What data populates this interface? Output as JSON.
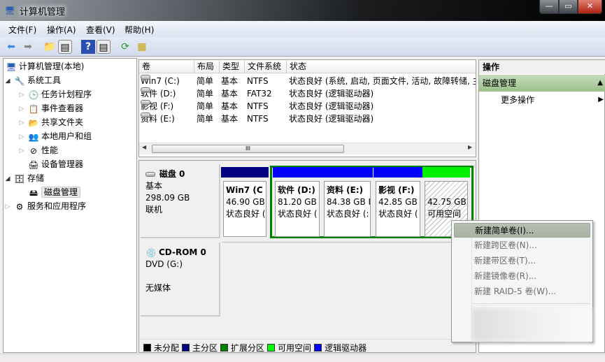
{
  "window": {
    "title": "计算机管理",
    "controls": [
      "minimize",
      "maximize",
      "close"
    ]
  },
  "menu": [
    {
      "label": "文件(F)"
    },
    {
      "label": "操作(A)"
    },
    {
      "label": "查看(V)"
    },
    {
      "label": "帮助(H)"
    }
  ],
  "toolbar": [
    "back-icon",
    "forward-icon",
    "up-folder-icon",
    "show-hide-tree-icon",
    "help-icon",
    "show-hide-action-icon",
    "refresh-icon",
    "properties-icon"
  ],
  "tree": {
    "root": "计算机管理(本地)",
    "items": [
      {
        "label": "系统工具",
        "level": 1,
        "expanded": true
      },
      {
        "label": "任务计划程序",
        "level": 2
      },
      {
        "label": "事件查看器",
        "level": 2
      },
      {
        "label": "共享文件夹",
        "level": 2
      },
      {
        "label": "本地用户和组",
        "level": 2
      },
      {
        "label": "性能",
        "level": 2
      },
      {
        "label": "设备管理器",
        "level": 2
      },
      {
        "label": "存储",
        "level": 1,
        "expanded": true
      },
      {
        "label": "磁盘管理",
        "level": 2,
        "selected": true
      },
      {
        "label": "服务和应用程序",
        "level": 1
      }
    ]
  },
  "volumes": {
    "columns": [
      "卷",
      "布局",
      "类型",
      "文件系统",
      "状态"
    ],
    "rows": [
      {
        "vol": "Win7 (C:)",
        "layout": "简单",
        "type": "基本",
        "fs": "NTFS",
        "status": "状态良好 (系统, 启动, 页面文件, 活动, 故障转储, 主"
      },
      {
        "vol": "软件 (D:)",
        "layout": "简单",
        "type": "基本",
        "fs": "FAT32",
        "status": "状态良好 (逻辑驱动器)"
      },
      {
        "vol": "影视 (F:)",
        "layout": "简单",
        "type": "基本",
        "fs": "NTFS",
        "status": "状态良好 (逻辑驱动器)"
      },
      {
        "vol": "资料 (E:)",
        "layout": "简单",
        "type": "基本",
        "fs": "NTFS",
        "status": "状态良好 (逻辑驱动器)"
      }
    ],
    "scroll_grip": "III"
  },
  "disk0": {
    "name": "磁盘 0",
    "type": "基本",
    "size": "298.09 GB",
    "state": "联机",
    "partitions": [
      {
        "name": "Win7  (C",
        "size": "46.90 GB",
        "status": "状态良好 (",
        "color": "#000080"
      },
      {
        "name": "软件  (D:)",
        "size": "81.20 GB",
        "status": "状态良好 (",
        "color": "#0000ff"
      },
      {
        "name": "资料  (E:)",
        "size": "84.38 GB I",
        "status": "状态良好 (:",
        "color": "#0000ff"
      },
      {
        "name": "影视  (F:)",
        "size": "42.85 GB",
        "status": "状态良好 (",
        "color": "#0000ff"
      },
      {
        "name": "",
        "size": "42.75 GB",
        "status": "可用空间",
        "color": "#00ee00"
      }
    ]
  },
  "cdrom": {
    "name": "CD-ROM 0",
    "drive": "DVD (G:)",
    "media": "无媒体"
  },
  "legend": [
    {
      "label": "未分配",
      "color": "#000000"
    },
    {
      "label": "主分区",
      "color": "#000080"
    },
    {
      "label": "扩展分区",
      "color": "#008000"
    },
    {
      "label": "可用空间",
      "color": "#00ff00"
    },
    {
      "label": "逻辑驱动器",
      "color": "#0000ff"
    }
  ],
  "actions": {
    "header": "操作",
    "section": "磁盘管理",
    "more": "更多操作"
  },
  "context_menu": [
    {
      "label": "新建简单卷(I)...",
      "enabled": true
    },
    {
      "label": "新建跨区卷(N)...",
      "enabled": false
    },
    {
      "label": "新建带区卷(T)...",
      "enabled": false
    },
    {
      "label": "新建镜像卷(R)...",
      "enabled": false
    },
    {
      "label": "新建 RAID-5 卷(W)...",
      "enabled": false
    }
  ]
}
